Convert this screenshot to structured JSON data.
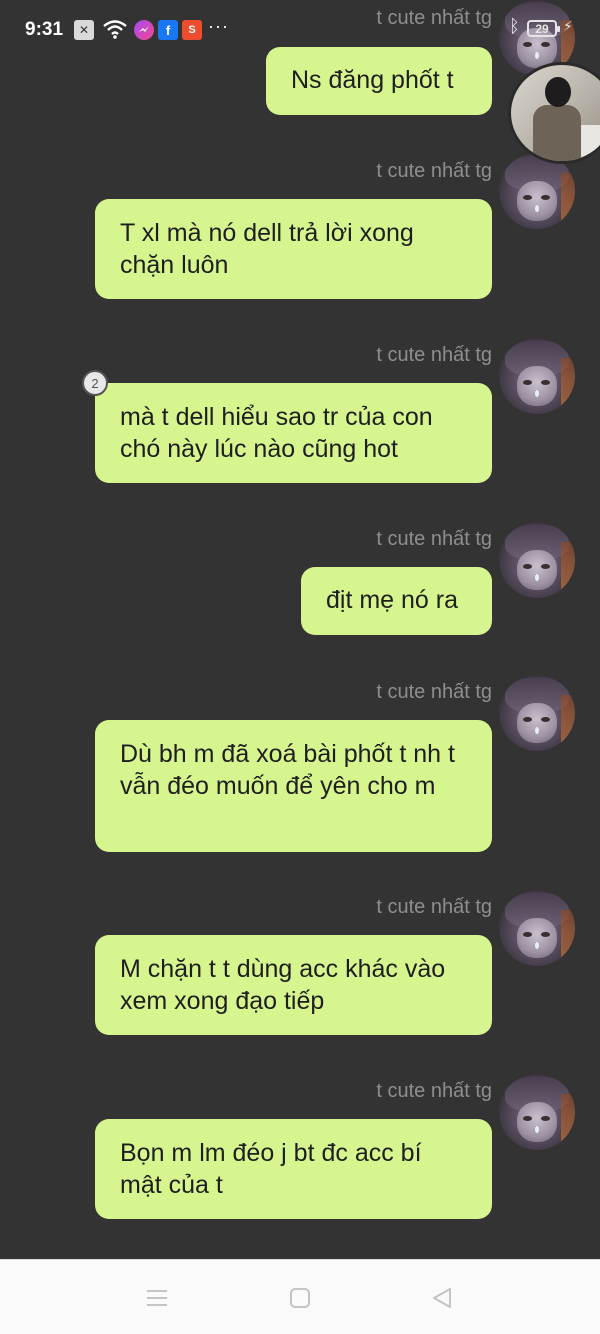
{
  "status_bar": {
    "time": "9:31",
    "battery_level": "29",
    "icons": [
      "x-box-icon",
      "wifi-icon",
      "messenger-icon",
      "facebook-icon",
      "shopee-icon",
      "more-dots-icon",
      "bluetooth-icon",
      "battery-icon",
      "charging-icon"
    ]
  },
  "messages": [
    {
      "sender": "t cute nhất tg",
      "text": "Ns đăng phốt t"
    },
    {
      "sender": "t cute nhất tg",
      "text": "T xl mà nó dell trả lời xong chặn luôn"
    },
    {
      "sender": "t cute nhất tg",
      "text": "mà t dell hiểu sao tr của con chó này lúc nào cũng hot",
      "reaction_count": "2"
    },
    {
      "sender": "t cute nhất tg",
      "text": "địt mẹ nó ra"
    },
    {
      "sender": "t cute nhất tg",
      "text": "Dù bh m đã xoá bài phốt t nh t vẫn đéo muốn để yên cho m"
    },
    {
      "sender": "t cute nhất tg",
      "text": "M chặn t t dùng acc khác vào xem xong đạo tiếp"
    },
    {
      "sender": "t cute nhất tg",
      "text": "Bọn m lm đéo j bt đc acc bí mật của t"
    }
  ],
  "colors": {
    "background": "#333333",
    "bubble": "#d7f58f",
    "sender_text": "#8e8e8e",
    "nav_bar": "#fafafa"
  },
  "nav_bar": {
    "buttons": [
      "menu-icon",
      "home-square-icon",
      "back-triangle-icon"
    ]
  }
}
